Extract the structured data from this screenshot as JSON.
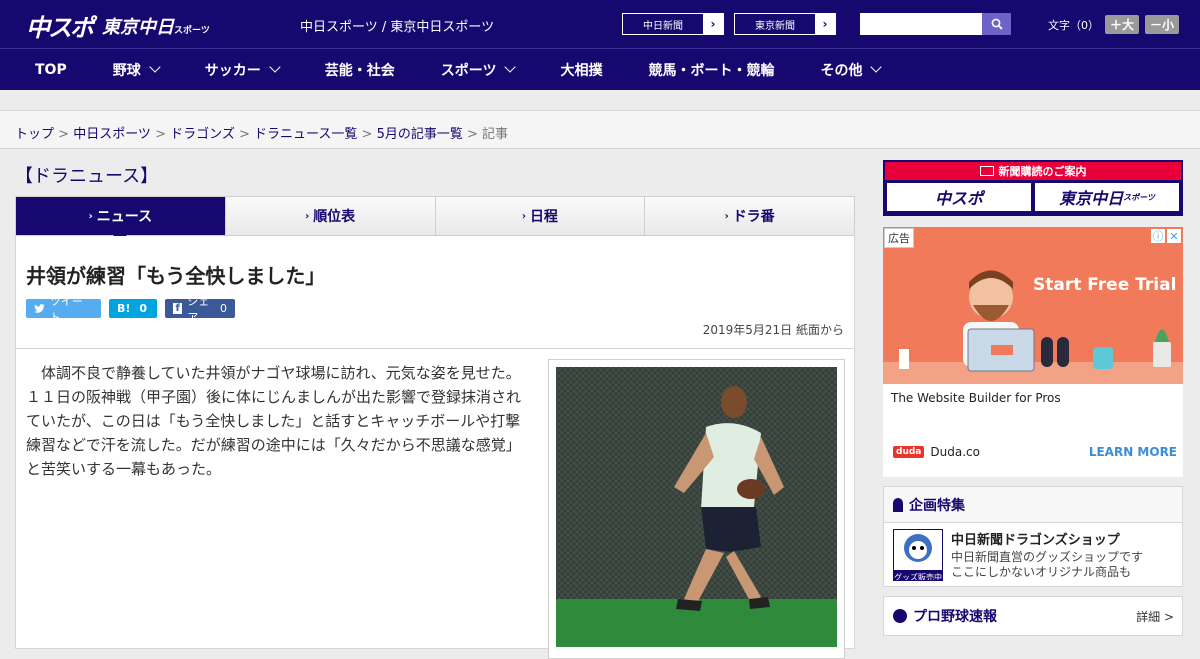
{
  "header": {
    "logo_main": "中スポ",
    "logo_sub": "東京中日",
    "logo_sub_small": "スポーツ",
    "site_names": "中日スポーツ / 東京中日スポーツ",
    "pill_chunichi": "中日新聞",
    "pill_tokyo": "東京新聞",
    "search_placeholder": "",
    "font_label": "文字（0）",
    "font_bigger": "＋大",
    "font_smaller": "－小"
  },
  "nav": {
    "items": [
      {
        "label": "TOP",
        "has_menu": false
      },
      {
        "label": "野球",
        "has_menu": true
      },
      {
        "label": "サッカー",
        "has_menu": true
      },
      {
        "label": "芸能・社会",
        "has_menu": false
      },
      {
        "label": "スポーツ",
        "has_menu": true
      },
      {
        "label": "大相撲",
        "has_menu": false
      },
      {
        "label": "競馬・ボート・競輪",
        "has_menu": false
      },
      {
        "label": "その他",
        "has_menu": true
      }
    ]
  },
  "breadcrumb": {
    "items": [
      "トップ",
      "中日スポーツ",
      "ドラゴンズ",
      "ドラニュース一覧",
      "5月の記事一覧"
    ],
    "current": "記事",
    "sep": " > "
  },
  "section": {
    "title": "【ドラニュース】",
    "tabs": [
      "ニュース",
      "順位表",
      "日程",
      "ドラ番"
    ],
    "active_tab": 0
  },
  "article": {
    "headline": "井領が練習「もう全快しました」",
    "tweet_label": "ツイート",
    "hatena_label": "B!",
    "hatena_count": "0",
    "facebook_label": "シェア",
    "facebook_count": "0",
    "date": "2019年5月21日 紙面から",
    "body": "体調不良で静養していた井領がナゴヤ球場に訪れ、元気な姿を見せた。１１日の阪神戦（甲子園）後に体にじんましんが出た影響で登録抹消されていたが、この日は「もう全快しました」と話すとキャッチボールや打撃練習などで汗を流した。だが練習の途中には「久々だから不思議な感覚」と苦笑いする一幕もあった。"
  },
  "sidebar": {
    "subscribe_title": "新聞購読のご案内",
    "subscribe_chuspo": "中スポ",
    "subscribe_tokyo": "東京中日",
    "subscribe_tokyo_small": "スポーツ",
    "ad_label": "広告",
    "ad_cta": "Start Free Trial",
    "ad_tagline": "The Website Builder for Pros",
    "ad_brand_logo": "duda",
    "ad_brand": "Duda.co",
    "ad_learn": "LEARN MORE",
    "feature_heading": "企画特集",
    "feature_title": "中日新聞ドラゴンズショップ",
    "feature_desc1": "中日新聞直営のグッズショップです",
    "feature_desc2": "ここにしかないオリジナル商品も",
    "feature_thumb_text": "グッズ販売中",
    "quick_heading": "プロ野球速報",
    "quick_more": "詳細 >"
  },
  "colors": {
    "brand_navy": "#16086e",
    "subscribe_red": "#e9003a",
    "twitter": "#55acee",
    "hatena": "#00a4de",
    "facebook": "#3b5998",
    "ad_bg": "#f07a5a"
  }
}
